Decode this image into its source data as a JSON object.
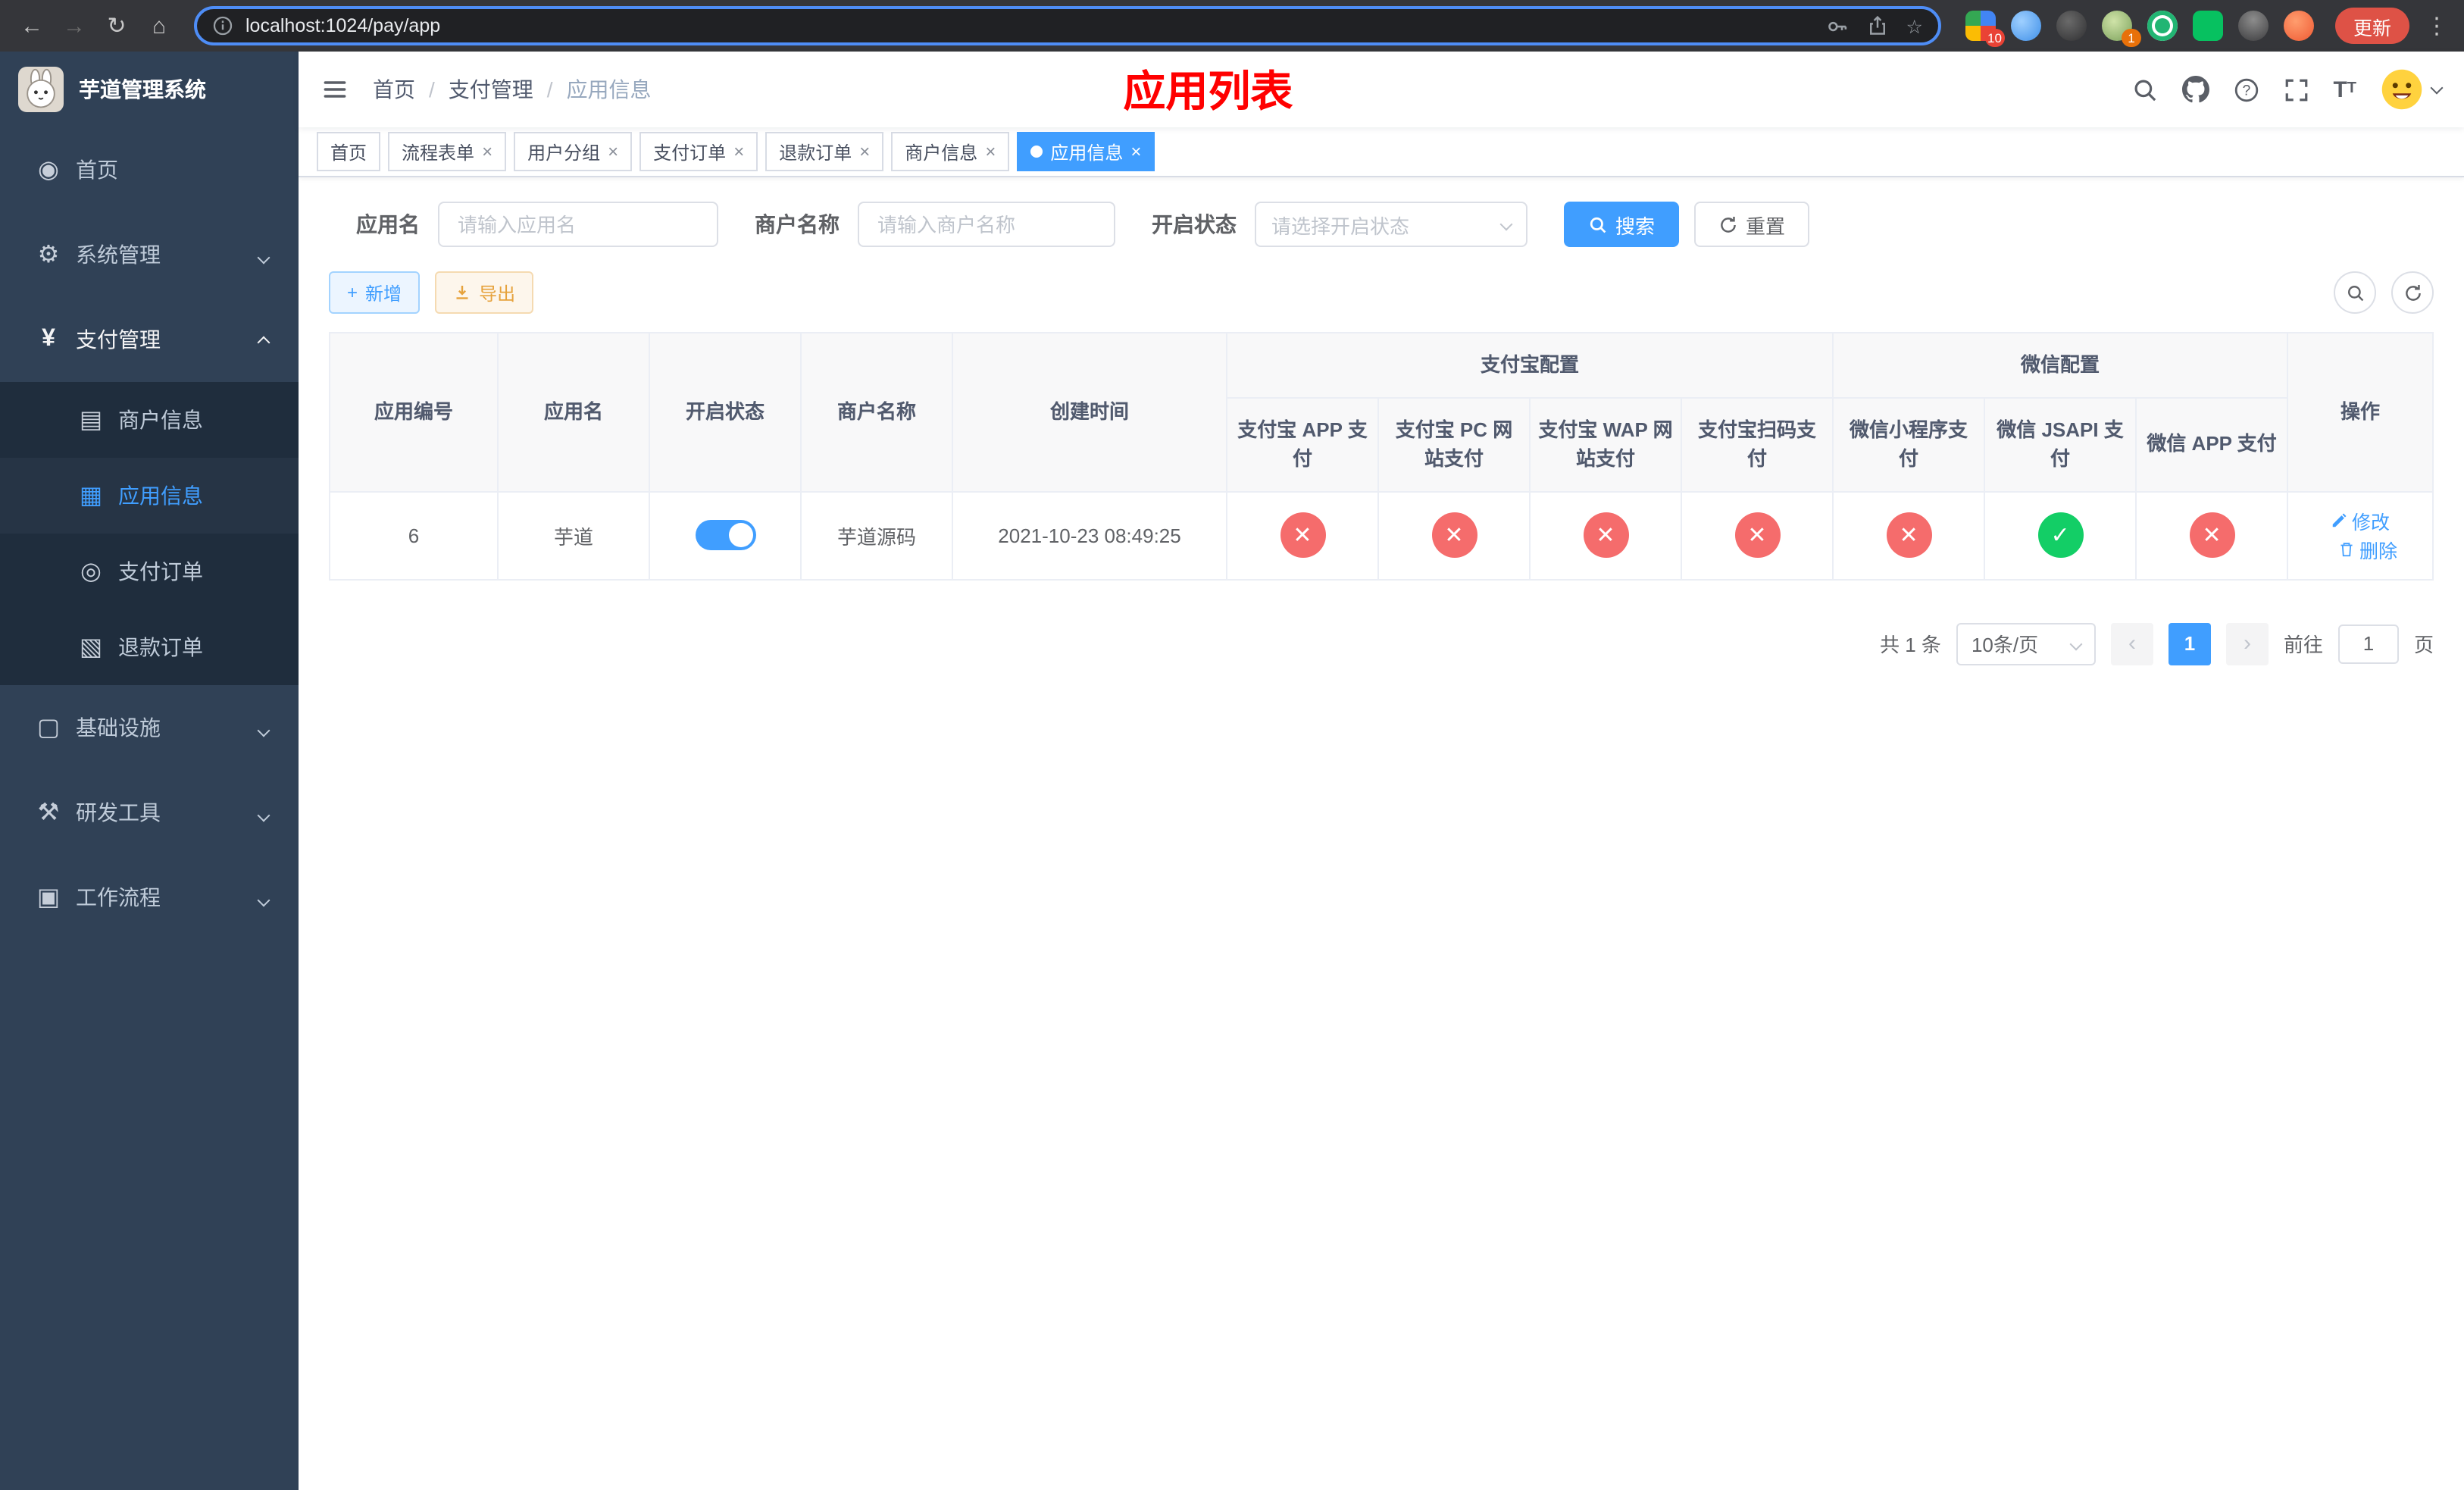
{
  "colors": {
    "primary": "#409eff",
    "danger": "#f56c6c",
    "success": "#13ce66",
    "title_red": "#ff0000",
    "sidebar_bg": "#304156",
    "submenu_bg": "#1f2d3d"
  },
  "icons": {
    "back": "←",
    "forward": "→",
    "reload": "↻",
    "home": "⌂",
    "star": "☆",
    "kebab": "⋮",
    "close": "×",
    "plus": "+",
    "check": "✓",
    "cross": "✕",
    "prev": "‹",
    "next": "›",
    "dashboard": "◉",
    "gear": "⚙",
    "yen": "¥",
    "merchant": "▤",
    "app": "▦",
    "order": "◎",
    "refund": "▧",
    "infra": "▢",
    "tools": "⚒",
    "workflow": "▣"
  },
  "browser": {
    "url": "localhost:1024/pay/app",
    "update_label": "更新",
    "ext_badge_red": "10",
    "ext_badge_amber": "1"
  },
  "sidebar": {
    "logo_title": "芋道管理系统",
    "items": [
      {
        "label": "首页"
      },
      {
        "label": "系统管理"
      },
      {
        "label": "支付管理"
      },
      {
        "label": "基础设施"
      },
      {
        "label": "研发工具"
      },
      {
        "label": "工作流程"
      }
    ],
    "pay_submenu": [
      {
        "label": "商户信息"
      },
      {
        "label": "应用信息"
      },
      {
        "label": "支付订单"
      },
      {
        "label": "退款订单"
      }
    ]
  },
  "navbar": {
    "breadcrumb": [
      "首页",
      "支付管理",
      "应用信息"
    ],
    "page_title": "应用列表"
  },
  "tags": [
    {
      "label": "首页"
    },
    {
      "label": "流程表单"
    },
    {
      "label": "用户分组"
    },
    {
      "label": "支付订单"
    },
    {
      "label": "退款订单"
    },
    {
      "label": "商户信息"
    },
    {
      "label": "应用信息"
    }
  ],
  "filters": {
    "app_name_label": "应用名",
    "app_name_placeholder": "请输入应用名",
    "merchant_label": "商户名称",
    "merchant_placeholder": "请输入商户名称",
    "status_label": "开启状态",
    "status_placeholder": "请选择开启状态",
    "search_label": "搜索",
    "reset_label": "重置"
  },
  "toolbar": {
    "add_label": "新增",
    "export_label": "导出"
  },
  "table": {
    "headers": {
      "app_id": "应用编号",
      "app_name": "应用名",
      "status": "开启状态",
      "merchant": "商户名称",
      "created": "创建时间",
      "alipay_group": "支付宝配置",
      "wechat_group": "微信配置",
      "actions": "操作",
      "alipay_app": "支付宝 APP 支付",
      "alipay_pc": "支付宝 PC 网站支付",
      "alipay_wap": "支付宝 WAP 网站支付",
      "alipay_qr": "支付宝扫码支付",
      "wx_mini": "微信小程序支付",
      "wx_jsapi": "微信 JSAPI 支付",
      "wx_app": "微信 APP 支付"
    },
    "row": {
      "id": "6",
      "name": "芋道",
      "enabled": true,
      "merchant": "芋道源码",
      "created": "2021-10-23 08:49:25",
      "statuses": {
        "alipay_app": false,
        "alipay_pc": false,
        "alipay_wap": false,
        "alipay_qr": false,
        "wx_mini": false,
        "wx_jsapi": true,
        "wx_app": false
      },
      "edit_label": "修改",
      "delete_label": "删除"
    }
  },
  "pagination": {
    "total": "共 1 条",
    "page_size": "10条/页",
    "page": "1",
    "goto_prefix": "前往",
    "goto_value": "1",
    "goto_suffix": "页"
  }
}
